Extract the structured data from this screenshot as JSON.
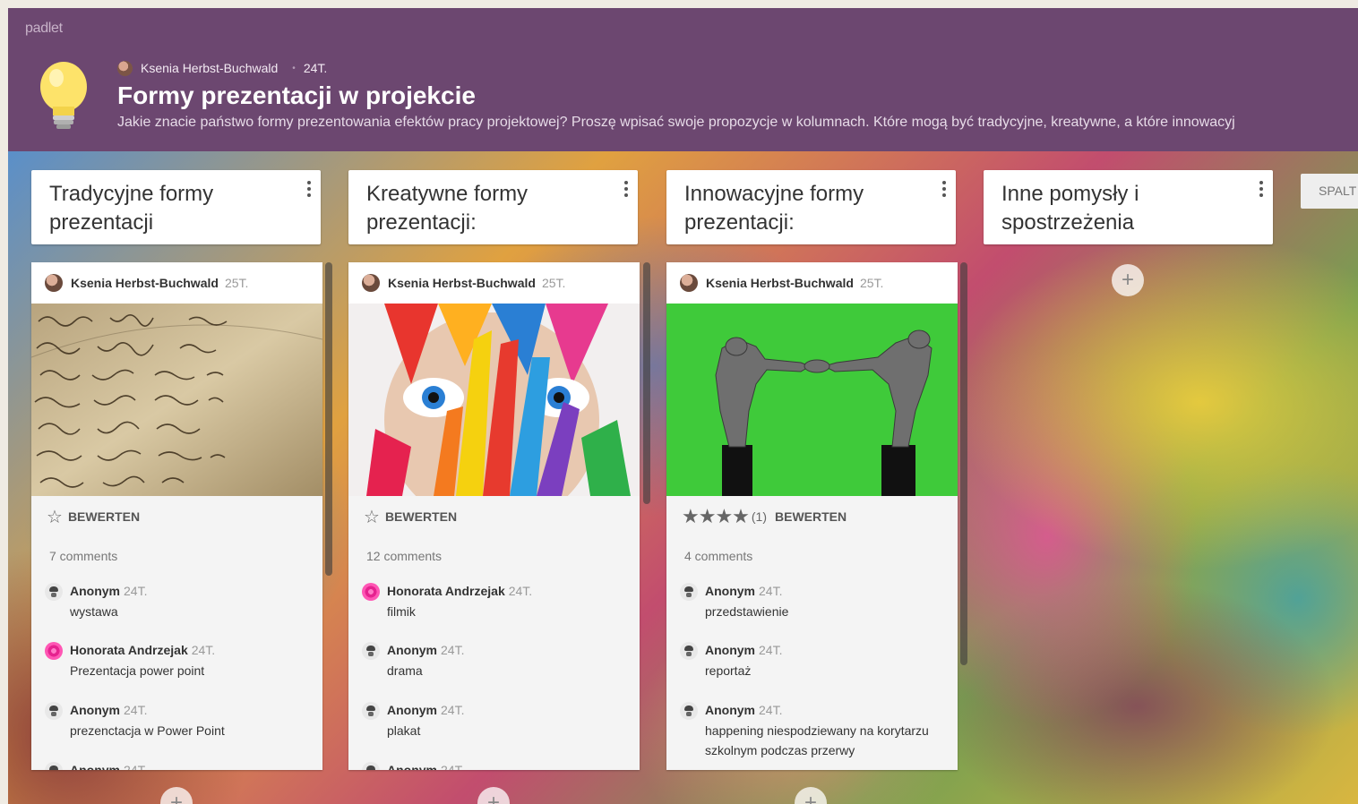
{
  "app": {
    "logo": "padlet"
  },
  "header": {
    "author": "Ksenia Herbst-Buchwald",
    "separator": "•",
    "date": "24T.",
    "title": "Formy prezentacji w projekcie",
    "subtitle": "Jakie znacie państwo formy prezentowania efektów pracy projektowej? Proszę wpisać swoje propozycje w kolumnach. Które mogą być tradycyjne, kreatywne, a które innowacyj"
  },
  "columns": [
    {
      "title": "Tradycyjne formy prezentacji"
    },
    {
      "title": "Kreatywne formy prezentacji:"
    },
    {
      "title": "Innowacyjne formy prezentacji:"
    },
    {
      "title": "Inne pomysły i spostrzeżenia"
    }
  ],
  "add_column_label": "SPALT",
  "add_post_icon": "+",
  "cards": [
    {
      "author": "Ksenia Herbst-Buchwald",
      "time": "25T.",
      "image": "handwritten-letter",
      "rating_icon": "☆",
      "rate_label": "BEWERTEN",
      "comments_count": "7 comments",
      "comments": [
        {
          "name": "Anonym",
          "time": "24T.",
          "text": "wystawa",
          "avatar": "anon"
        },
        {
          "name": "Honorata Andrzejak",
          "time": "24T.",
          "text": "Prezentacja power point",
          "avatar": "pink"
        },
        {
          "name": "Anonym",
          "time": "24T.",
          "text": "prezenctacja w Power Point",
          "avatar": "anon"
        },
        {
          "name": "Anonym",
          "time": "24T.",
          "text": "",
          "avatar": "anon"
        }
      ]
    },
    {
      "author": "Ksenia Herbst-Buchwald",
      "time": "25T.",
      "image": "painted-face",
      "rating_icon": "☆",
      "rate_label": "BEWERTEN",
      "comments_count": "12 comments",
      "comments": [
        {
          "name": "Honorata Andrzejak",
          "time": "24T.",
          "text": "filmik",
          "avatar": "pink"
        },
        {
          "name": "Anonym",
          "time": "24T.",
          "text": "drama",
          "avatar": "anon"
        },
        {
          "name": "Anonym",
          "time": "24T.",
          "text": "plakat",
          "avatar": "anon"
        },
        {
          "name": "Anonym",
          "time": "24T.",
          "text": "",
          "avatar": "anon"
        }
      ]
    },
    {
      "author": "Ksenia Herbst-Buchwald",
      "time": "25T.",
      "image": "sculpture-green",
      "rating_stars": "★★★★",
      "rating_stars_value": 4,
      "rating_count": "(1)",
      "rate_label": "BEWERTEN",
      "comments_count": "4 comments",
      "comments": [
        {
          "name": "Anonym",
          "time": "24T.",
          "text": "przedstawienie",
          "avatar": "anon"
        },
        {
          "name": "Anonym",
          "time": "24T.",
          "text": "reportaż",
          "avatar": "anon"
        },
        {
          "name": "Anonym",
          "time": "24T.",
          "text": "happening niespodziewany na korytarzu szkolnym podczas przerwy",
          "avatar": "anon"
        }
      ]
    }
  ],
  "colors": {
    "header_bg": "#6c4770",
    "card_bg": "#f4f4f4",
    "green_bg": "#3fca3a"
  }
}
